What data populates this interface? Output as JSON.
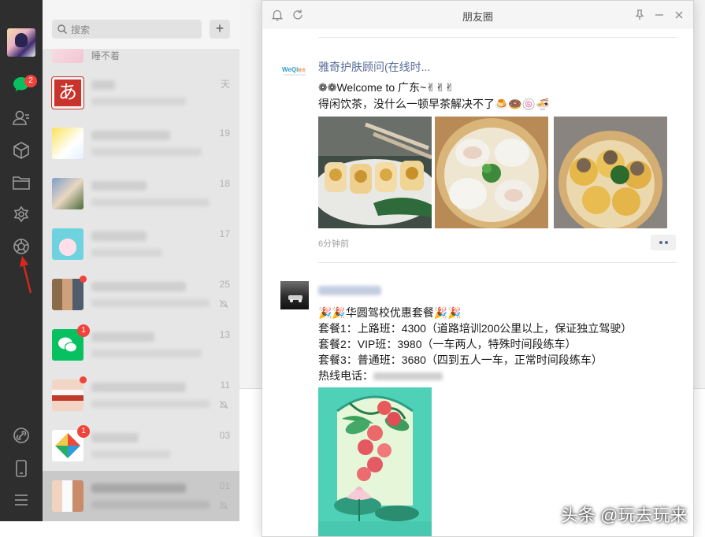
{
  "sidebar": {
    "chat_badge": "2",
    "icons": [
      "chat-icon",
      "contacts-icon",
      "favorites-cube-icon",
      "files-folder-icon",
      "mini-programs-icon",
      "moments-aperture-icon",
      "link-icon",
      "phone-icon",
      "menu-icon"
    ]
  },
  "chatlist": {
    "search_placeholder": "搜索",
    "add_label": "+",
    "partial_top_text": "睡不着",
    "items": [
      {
        "time": "天",
        "badge": "",
        "muted": false
      },
      {
        "time": "19",
        "badge": "",
        "muted": false
      },
      {
        "time": "18",
        "badge": "",
        "muted": false
      },
      {
        "time": "17",
        "badge": "",
        "muted": false
      },
      {
        "time": "25",
        "badge": "dot",
        "muted": true
      },
      {
        "time": "13",
        "badge": "1",
        "muted": false
      },
      {
        "time": "11",
        "badge": "dot",
        "muted": true
      },
      {
        "time": "03",
        "badge": "1",
        "muted": false
      },
      {
        "time": "01",
        "badge": "",
        "muted": true
      }
    ],
    "avatar_glyph": "あ"
  },
  "moments_window": {
    "title": "朋友圈",
    "posts": [
      {
        "author": "雅奇护肤顾问(在线时...",
        "avatar_text": "WeQi 雅奇",
        "lines": [
          "❁❁Welcome  to 广东~✌✌✌",
          "得闲饮茶，没什么一顿早茶解决不了🍮🍩🍥🍜"
        ],
        "time": "6分钟前",
        "photos": [
          "spring-rolls-photo",
          "har-gow-dumplings-photo",
          "siu-mai-photo"
        ]
      },
      {
        "lines": [
          "🎉🎉华圆驾校优惠套餐🎉🎉",
          " 套餐1：上路班：4300（道路培训200公里以上，保证独立驾驶）",
          " 套餐2：VIP班：3980（一车两人，特殊时间段练车）",
          " 套餐3：普通班：3680（四到五人一车，正常时间段练车）",
          "热线电话："
        ],
        "poster": "lychee-lotus-poster"
      }
    ]
  },
  "watermark": "头条 @玩去玩来",
  "colors": {
    "sidebar_bg": "#2e2e2e",
    "link_blue": "#576b95",
    "badge_red": "#f0433b"
  }
}
